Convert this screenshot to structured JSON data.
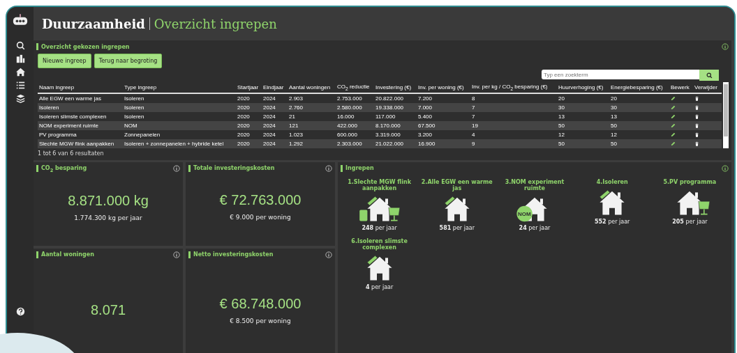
{
  "header": {
    "title": "Duurzaamheid",
    "subtitle": "Overzicht ingrepen"
  },
  "sidebar": {
    "items": [
      {
        "kind": "search"
      },
      {
        "kind": "buildings"
      },
      {
        "kind": "home"
      },
      {
        "kind": "list"
      },
      {
        "kind": "layers"
      }
    ]
  },
  "overview": {
    "title": "Overzicht gekozen ingrepen",
    "buttons": [
      "Nieuwe ingreep",
      "Terug naar begroting"
    ],
    "search": {
      "placeholder": "Typ een zoekterm"
    },
    "table": {
      "columns": [
        "Naam ingreep",
        "Type ingreep",
        "Startjaar",
        "Eindjaar",
        "Aantal woningen",
        "CO$_{2}$ reductie",
        "Investering (€)",
        "Inv. per woning (€)",
        "Inv. per kg / CO$_{2}$ besparing (€)",
        "Huurverhoging (€)",
        "Energiebesparing (€)",
        "Bewerk",
        "Verwijder"
      ],
      "rows": [
        [
          "Alle EGW een warme jas",
          "Isoleren",
          "2020",
          "2024",
          "2.903",
          "2.753.000",
          "20.822.000",
          "7.200",
          "8",
          "20",
          "20"
        ],
        [
          "Isoleren",
          "Isoleren",
          "2020",
          "2024",
          "2.760",
          "2.580.000",
          "19.338.000",
          "7.000",
          "7",
          "30",
          "30"
        ],
        [
          "Isoleren slimste complexen",
          "Isoleren",
          "2020",
          "2024",
          "21",
          "16.000",
          "117.000",
          "5.400",
          "7",
          "13",
          "13"
        ],
        [
          "NOM experiment ruimte",
          "NOM",
          "2020",
          "2024",
          "121",
          "422.000",
          "8.170.000",
          "67.500",
          "19",
          "50",
          "50"
        ],
        [
          "PV programma",
          "Zonnepanelen",
          "2020",
          "2024",
          "1.023",
          "600.000",
          "3.319.000",
          "3.200",
          "4",
          "12",
          "12"
        ],
        [
          "Slechte MGW flink aanpakken",
          "Isoleren + zonnepanelen + hybride ketel",
          "2020",
          "2024",
          "1.292",
          "2.303.000",
          "21.022.000",
          "16.900",
          "9",
          "50",
          "50"
        ]
      ],
      "footer": "1 tot 6 van 6 resultaten"
    }
  },
  "cards": [
    {
      "title": "CO$_{2}$ besparing",
      "value": "8.871.000 kg",
      "sub": "1.774.300 kg per jaar"
    },
    {
      "title": "Totale investeringskosten",
      "value": "€ 72.763.000",
      "sub": "€ 9.000 per woning"
    },
    {
      "title": "Aantal woningen",
      "value": "8.071"
    },
    {
      "title": "Netto investeringskosten",
      "value": "€ 68.748.000",
      "sub": "€ 8.500 per woning"
    }
  ],
  "ingrepen": {
    "title": "Ingrepen",
    "items": [
      {
        "label": "1.Slechte MGW flink aanpakken",
        "kind": "hybrid",
        "count": "248",
        "unit": "per jaar"
      },
      {
        "label": "2.Alle EGW een warme jas",
        "kind": "roof-solar",
        "count": "581",
        "unit": "per jaar"
      },
      {
        "label": "3.NOM experiment ruimte",
        "kind": "nom",
        "badge": "NOM",
        "count": "24",
        "unit": "per jaar"
      },
      {
        "label": "4.Isoleren",
        "kind": "roof-solar",
        "count": "552",
        "unit": "per jaar"
      },
      {
        "label": "5.PV programma",
        "kind": "pv",
        "count": "205",
        "unit": "per jaar"
      },
      {
        "label": "6.Isoleren slimste complexen",
        "kind": "roof-solar",
        "count": "4",
        "unit": "per jaar"
      }
    ]
  }
}
